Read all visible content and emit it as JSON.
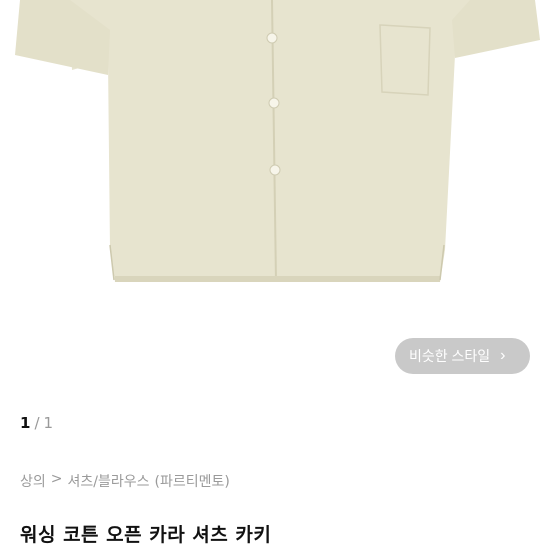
{
  "product": {
    "title": "워싱 코튼 오픈 카라 셔츠 카키",
    "image_alt": "beige short sleeve open collar shirt"
  },
  "similar_style": {
    "label": "비슷한 스타일",
    "icon": "chevron-right-icon"
  },
  "pager": {
    "current": "1",
    "separator": "/",
    "total": "1"
  },
  "breadcrumb": {
    "items": [
      "상의",
      ">",
      "셔츠/블라우스",
      "(파르티멘토)"
    ]
  },
  "colors": {
    "shirt": "#e7e4cf",
    "shirt_shadow": "#d4d0b6",
    "button_bg": "#c9c9c9"
  }
}
